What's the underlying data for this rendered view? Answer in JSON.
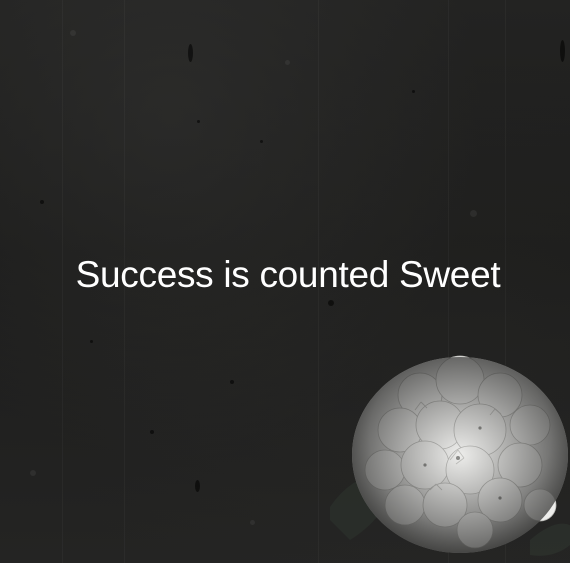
{
  "hero": {
    "headline": "Success is counted Sweet"
  },
  "images": {
    "background": "dark-concrete-wall",
    "decoration": "white-hydrangea-flower"
  },
  "colors": {
    "background": "#1d1d1c",
    "text": "#ffffff"
  }
}
